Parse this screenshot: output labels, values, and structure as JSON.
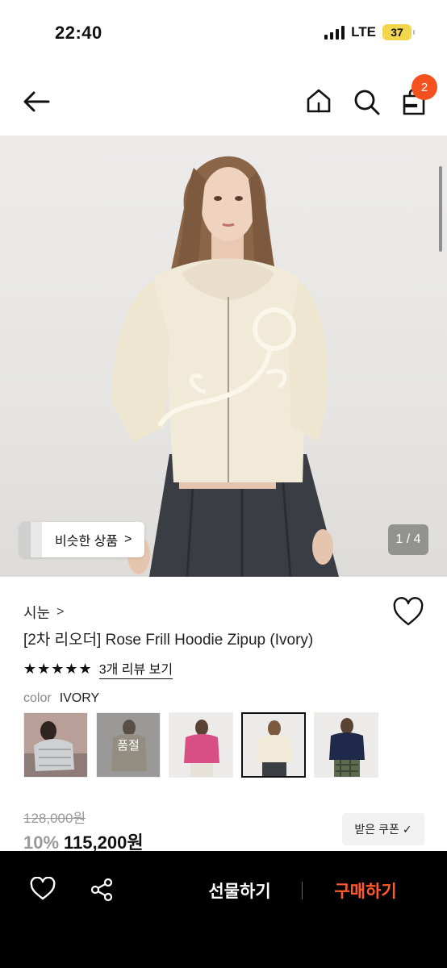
{
  "status_bar": {
    "time": "22:40",
    "network": "LTE",
    "battery": "37"
  },
  "nav": {
    "back_icon": "arrow-left-icon",
    "home_icon": "home-icon",
    "search_icon": "search-icon",
    "cart_icon": "shopping-bag-icon",
    "cart_count": "2",
    "badge_color": "#f4511e"
  },
  "hero": {
    "similar_label": "비슷한 상품",
    "similar_chevron": ">",
    "page_indicator": "1 / 4"
  },
  "product": {
    "brand": "시눈",
    "brand_chevron": ">",
    "title": "[2차 리오더] Rose Frill Hoodie Zipup (Ivory)",
    "rating_stars": "★★★★★",
    "rating": 5,
    "review_link": "3개 리뷰 보기",
    "color_key": "color",
    "color_value": "IVORY",
    "variants": [
      {
        "label": "grey",
        "soldout": false,
        "selected": false
      },
      {
        "label": "beige",
        "soldout": true,
        "soldout_text": "품절",
        "selected": false
      },
      {
        "label": "pink",
        "soldout": false,
        "selected": false
      },
      {
        "label": "ivory",
        "soldout": false,
        "selected": true
      },
      {
        "label": "navy",
        "soldout": false,
        "selected": false
      }
    ],
    "original_price": "128,000원",
    "discount": "10%",
    "sale_price": "115,200원",
    "coupon_label": "받은 쿠폰",
    "coupon_check": "✓"
  },
  "bottom_bar": {
    "wishlist_icon": "heart-outline-icon",
    "share_icon": "share-icon",
    "gift_label": "선물하기",
    "buy_label": "구매하기",
    "buy_color": "#ff5a2c"
  }
}
